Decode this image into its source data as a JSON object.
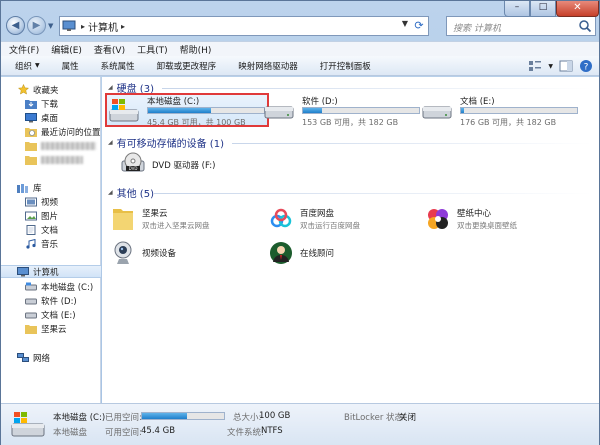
{
  "window": {
    "path_root": "计算机",
    "search_placeholder": "搜索 计算机",
    "controls": {
      "minimize": "–",
      "maximize": "□",
      "close": "✕"
    }
  },
  "menu": [
    "文件(F)",
    "编辑(E)",
    "查看(V)",
    "工具(T)",
    "帮助(H)"
  ],
  "toolbar": {
    "items": [
      "组织",
      "属性",
      "系统属性",
      "卸载或更改程序",
      "映射网络驱动器",
      "打开控制面板"
    ],
    "organize_caret": "▼"
  },
  "nav": {
    "favorites": "收藏夹",
    "downloads": "下载",
    "desktop": "桌面",
    "recent": "最近访问的位置",
    "library": "库",
    "videos": "视频",
    "pictures": "图片",
    "documents": "文档",
    "music": "音乐",
    "computer": "计算机",
    "drive_c": "本地磁盘 (C:)",
    "drive_d": "软件 (D:)",
    "drive_e": "文档 (E:)",
    "jianguoyun": "坚果云",
    "network": "网络"
  },
  "sections": {
    "hard_disks": "硬盘 (3)",
    "removable": "有可移动存储的设备 (1)",
    "other": "其他 (5)"
  },
  "drives": [
    {
      "name": "本地磁盘 (C:)",
      "info": "45.4 GB 可用，共 100 GB",
      "used_fraction": 0.546
    },
    {
      "name": "软件 (D:)",
      "info": "153 GB 可用，共 182 GB",
      "used_fraction": 0.16
    },
    {
      "name": "文档 (E:)",
      "info": "176 GB 可用，共 182 GB",
      "used_fraction": 0.03
    }
  ],
  "dvd": {
    "name": "DVD 驱动器 (F:)"
  },
  "others": [
    {
      "name": "坚果云",
      "sub": "双击进入坚果云网盘"
    },
    {
      "name": "百度网盘",
      "sub": "双击运行百度网盘"
    },
    {
      "name": "壁纸中心",
      "sub": "双击更换桌面壁纸"
    },
    {
      "name": "视频设备",
      "sub": ""
    },
    {
      "name": "在线顾问",
      "sub": ""
    }
  ],
  "details": {
    "name": "本地磁盘 (C:)",
    "type": "本地磁盘",
    "used_label": "已用空间:",
    "free_label": "可用空间:",
    "free_value": "45.4 GB",
    "total_label": "总大小:",
    "total_value": "100 GB",
    "fs_label": "文件系统:",
    "fs_value": "NTFS",
    "bitlocker_label": "BitLocker 状态:",
    "bitlocker_value": "关闭",
    "used_fraction": 0.546
  }
}
